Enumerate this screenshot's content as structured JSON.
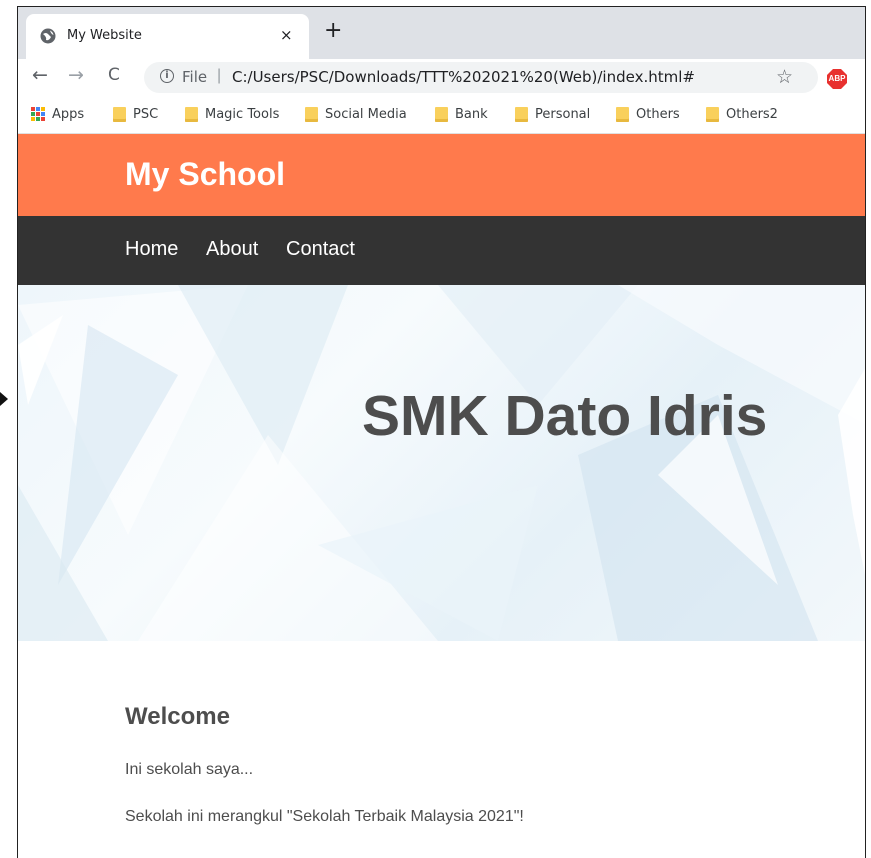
{
  "browser": {
    "tab_title": "My Website",
    "tab_close": "×",
    "new_tab": "+",
    "back": "←",
    "forward": "→",
    "reload": "C",
    "info": "i",
    "url_scheme": "File",
    "url_separator": "|",
    "url": "C:/Users/PSC/Downloads/TTT%202021%20(Web)/index.html#",
    "bookmark_star": "☆",
    "extension": "ABP",
    "bookmarks": [
      "Apps",
      "PSC",
      "Magic Tools",
      "Social Media",
      "Bank",
      "Personal",
      "Others",
      "Others2"
    ]
  },
  "site": {
    "title": "My School",
    "nav": [
      "Home",
      "About",
      "Contact"
    ],
    "hero_title": "SMK Dato Idris",
    "content": {
      "heading": "Welcome",
      "paragraphs": [
        "Ini sekolah saya...",
        "Sekolah ini merangkul \"Sekolah Terbaik Malaysia 2021\"!"
      ]
    }
  },
  "colors": {
    "header_bg": "#ff7a4c",
    "nav_bg": "#333333",
    "text_dark": "#4d4d4d",
    "tab_strip": "#dee1e6"
  }
}
